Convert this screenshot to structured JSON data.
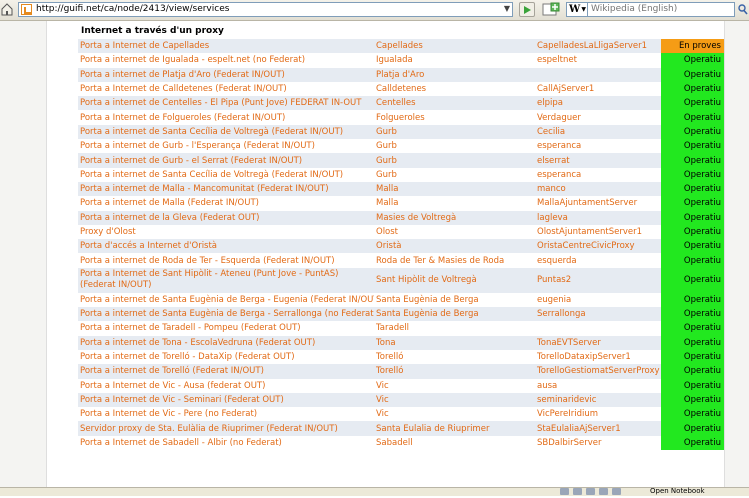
{
  "browser": {
    "url": "http://guifi.net/ca/node/2413/view/services",
    "search_placeholder": "Wikipedia (English)",
    "search_engine_letter": "W"
  },
  "section_title": "Internet a través d'un proxy",
  "colors": {
    "link": "#e26a15",
    "status_ok": "#22e81f",
    "status_testing": "#f59c15",
    "row_alt": "#e6ebf2"
  },
  "rows": [
    {
      "name": "Porta a Internet de Capellades",
      "location": "Capellades",
      "server": "CapelladesLaLligaServer1",
      "status": "En proves",
      "state": "testing"
    },
    {
      "name": "Porta a internet de Igualada - espelt.net (no Federat)",
      "location": "Igualada",
      "server": "espeltnet",
      "status": "Operatiu",
      "state": "ok"
    },
    {
      "name": "Porta a internet de Platja d'Aro (Federat IN/OUT)",
      "location": "Platja d'Aro",
      "server": "",
      "status": "Operatiu",
      "state": "ok"
    },
    {
      "name": "Porta a Internet de Calldetenes (Federat IN/OUT)",
      "location": "Calldetenes",
      "server": "CallAjServer1",
      "status": "Operatiu",
      "state": "ok"
    },
    {
      "name": "Porta a internet de Centelles - El Pipa (Punt Jove) FEDERAT IN-OUT",
      "location": "Centelles",
      "server": "elpipa",
      "status": "Operatiu",
      "state": "ok"
    },
    {
      "name": "Porta a Internet de Folgueroles (Federat IN/OUT)",
      "location": "Folgueroles",
      "server": "Verdaguer",
      "status": "Operatiu",
      "state": "ok"
    },
    {
      "name": "Porta a internet de Santa Cecília de Voltregà (Federat IN/OUT)",
      "location": "Gurb",
      "server": "Cecilia",
      "status": "Operatiu",
      "state": "ok"
    },
    {
      "name": "Porta a internet de Gurb - l'Esperança (Federat IN/OUT)",
      "location": "Gurb",
      "server": "esperanca",
      "status": "Operatiu",
      "state": "ok"
    },
    {
      "name": "Porta a internet de Gurb - el Serrat (Federat IN/OUT)",
      "location": "Gurb",
      "server": "elserrat",
      "status": "Operatiu",
      "state": "ok"
    },
    {
      "name": "Porta a internet de Santa Cecília de Voltregà (Federat IN/OUT)",
      "location": "Gurb",
      "server": "esperanca",
      "status": "Operatiu",
      "state": "ok"
    },
    {
      "name": "Porta a internet de Malla - Mancomunitat (Federat IN/OUT)",
      "location": "Malla",
      "server": "manco",
      "status": "Operatiu",
      "state": "ok"
    },
    {
      "name": "Porta a internet de Malla (Federat IN/OUT)",
      "location": "Malla",
      "server": "MallaAjuntamentServer",
      "status": "Operatiu",
      "state": "ok"
    },
    {
      "name": "Porta a internet de la Gleva (Federat OUT)",
      "location": "Masies de Voltregà",
      "server": "lagleva",
      "status": "Operatiu",
      "state": "ok"
    },
    {
      "name": "Proxy d'Olost",
      "location": "Olost",
      "server": "OlostAjuntamentServer1",
      "status": "Operatiu",
      "state": "ok"
    },
    {
      "name": "Porta d'accés a Internet d'Oristà",
      "location": "Oristà",
      "server": "OristaCentreCivicProxy",
      "status": "Operatiu",
      "state": "ok"
    },
    {
      "name": "Porta a internet de Roda de Ter - Esquerda (Federat IN/OUT)",
      "location": "Roda de Ter & Masies de Roda",
      "server": "esquerda",
      "status": "Operatiu",
      "state": "ok"
    },
    {
      "name": "Porta a Internet de Sant Hipòlit - Ateneu (Punt Jove - PuntAS) (Federat IN/OUT)",
      "location": "Sant Hipòlit de Voltregà",
      "server": "Puntas2",
      "status": "Operatiu",
      "state": "ok",
      "tall": true
    },
    {
      "name": "Porta a internet de Santa Eugènia de Berga - Eugenia (Federat IN/OUT)",
      "location": "Santa Eugènia de Berga",
      "server": "eugenia",
      "status": "Operatiu",
      "state": "ok"
    },
    {
      "name": "Porta a internet de Santa Eugènia de Berga - Serrallonga (no Federat)",
      "location": "Santa Eugènia de Berga",
      "server": "Serrallonga",
      "status": "Operatiu",
      "state": "ok"
    },
    {
      "name": "Porta a internet de Taradell - Pompeu (Federat OUT)",
      "location": "Taradell",
      "server": "",
      "status": "Operatiu",
      "state": "ok"
    },
    {
      "name": "Porta a internet de Tona - EscolaVedruna (Federat OUT)",
      "location": "Tona",
      "server": "TonaEVTServer",
      "status": "Operatiu",
      "state": "ok"
    },
    {
      "name": "Porta a internet de Torelló - DataXip (Federat OUT)",
      "location": "Torelló",
      "server": "TorelloDataxipServer1",
      "status": "Operatiu",
      "state": "ok"
    },
    {
      "name": "Porta a internet de Torelló (Federat IN/OUT)",
      "location": "Torelló",
      "server": "TorelloGestiomatServerProxy",
      "status": "Operatiu",
      "state": "ok"
    },
    {
      "name": "Porta a Internet de Vic - Ausa (federat OUT)",
      "location": "Vic",
      "server": "ausa",
      "status": "Operatiu",
      "state": "ok"
    },
    {
      "name": "Porta a Internet de Vic - Seminari (Federat OUT)",
      "location": "Vic",
      "server": "seminaridevic",
      "status": "Operatiu",
      "state": "ok"
    },
    {
      "name": "Porta a Internet de Vic - Pere (no Federat)",
      "location": "Vic",
      "server": "VicPereIridium",
      "status": "Operatiu",
      "state": "ok"
    },
    {
      "name": "Servidor proxy de Sta. Eulàlia de Riuprimer (Federat IN/OUT)",
      "location": "Santa Eulalia de Riuprimer",
      "server": "StaEulaliaAjServer1",
      "status": "Operatiu",
      "state": "ok"
    },
    {
      "name": "Porta a Internet de Sabadell - Albir (no Federat)",
      "location": "Sabadell",
      "server": "SBDalbirServer",
      "status": "Operatiu",
      "state": "ok"
    }
  ],
  "statusbar": {
    "text": "Open Notebook"
  }
}
